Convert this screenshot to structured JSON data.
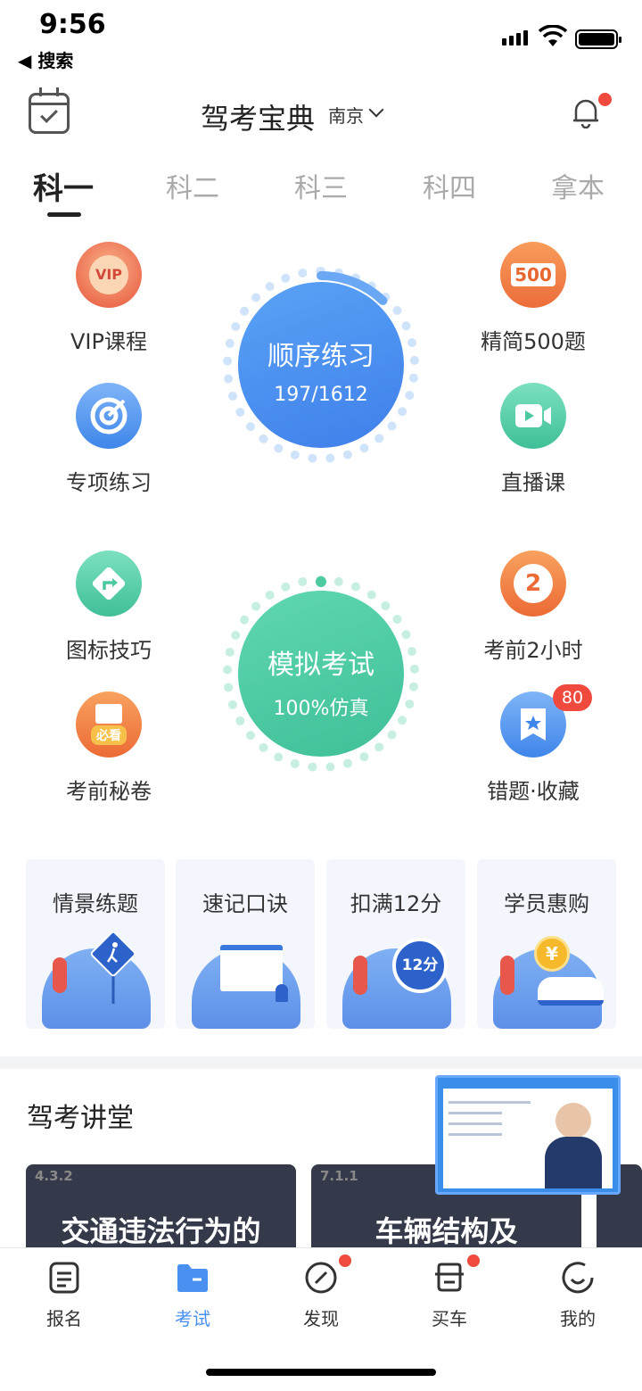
{
  "status": {
    "time": "9:56",
    "back_label": "搜索"
  },
  "header": {
    "title": "驾考宝典",
    "city": "南京"
  },
  "tabs": [
    {
      "label": "科一"
    },
    {
      "label": "科二"
    },
    {
      "label": "科三"
    },
    {
      "label": "科四"
    },
    {
      "label": "拿本"
    }
  ],
  "features": {
    "vip": {
      "label": "VIP课程",
      "icon_text": "VIP"
    },
    "simple500": {
      "label": "精简500题",
      "icon_text": "500"
    },
    "special": {
      "label": "专项练习"
    },
    "live": {
      "label": "直播课"
    },
    "sign": {
      "label": "图标技巧"
    },
    "two_hours": {
      "label": "考前2小时",
      "icon_text": "2"
    },
    "secret": {
      "label": "考前秘卷",
      "icon_text": "必看"
    },
    "wrong": {
      "label": "错题·收藏",
      "badge": "80"
    }
  },
  "practice": {
    "title": "顺序练习",
    "progress": "197/1612",
    "progress_fraction": 0.122
  },
  "exam": {
    "title": "模拟考试",
    "subtitle": "100%仿真"
  },
  "cards": [
    {
      "label": "情景练题"
    },
    {
      "label": "速记口诀"
    },
    {
      "label": "扣满12分",
      "badge": "12分"
    },
    {
      "label": "学员惠购",
      "coin": "¥"
    }
  ],
  "lecture": {
    "title": "驾考讲堂",
    "items": [
      {
        "num": "4.3.2",
        "title": "交通违法行为的"
      },
      {
        "num": "7.1.1",
        "title": "车辆结构及"
      }
    ]
  },
  "nav": [
    {
      "label": "报名"
    },
    {
      "label": "考试"
    },
    {
      "label": "发现"
    },
    {
      "label": "买车"
    },
    {
      "label": "我的"
    }
  ],
  "colors": {
    "accent": "#4a90f0",
    "green": "#4ccaa0",
    "red": "#f04a3e"
  }
}
